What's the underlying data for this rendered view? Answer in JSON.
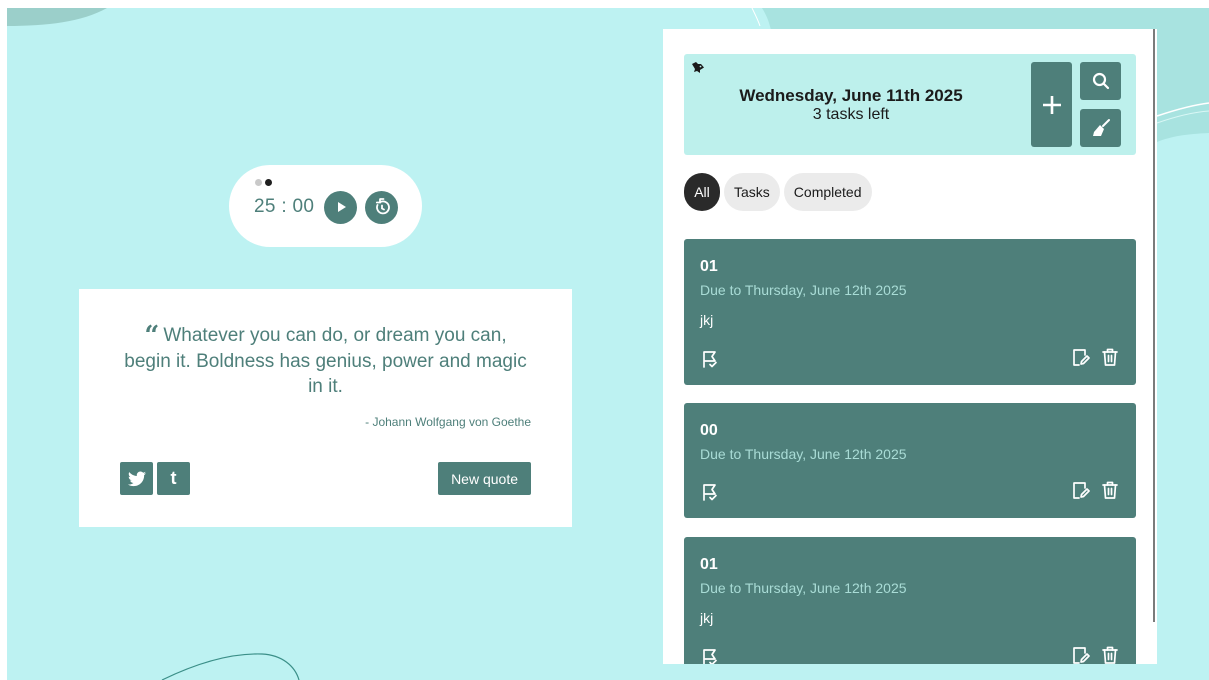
{
  "colors": {
    "background": "#bdf2f2",
    "accent": "#4e7f7a",
    "header_bg": "#bdf0ec",
    "due_text": "#a9dcd6"
  },
  "timer": {
    "time": "25 : 00",
    "session_dots": 2,
    "active_dot": 2,
    "icons": [
      "play-icon",
      "reset-timer-icon"
    ]
  },
  "quote": {
    "text": "Whatever you can do, or dream you can, begin it. Boldness has genius, power and magic in it.",
    "author": "- Johann Wolfgang von Goethe",
    "new_quote_label": "New quote",
    "share_icons": [
      "twitter-icon",
      "tumblr-icon"
    ],
    "tumblr_glyph": "t"
  },
  "todo": {
    "header": {
      "date": "Wednesday, June 11th 2025",
      "tasks_left": "3 tasks left",
      "icons": [
        "fish-icon",
        "plus-icon",
        "search-icon",
        "broom-icon"
      ]
    },
    "filters": [
      {
        "label": "All",
        "active": true
      },
      {
        "label": "Tasks",
        "active": false
      },
      {
        "label": "Completed",
        "active": false
      }
    ],
    "tasks": [
      {
        "title": "01",
        "due": "Due to Thursday, June 12th 2025",
        "description": "jkj"
      },
      {
        "title": "00",
        "due": "Due to Thursday, June 12th 2025",
        "description": ""
      },
      {
        "title": "01",
        "due": "Due to Thursday, June 12th 2025",
        "description": "jkj"
      }
    ],
    "task_icons": [
      "flag-check-icon",
      "edit-icon",
      "trash-icon"
    ]
  }
}
